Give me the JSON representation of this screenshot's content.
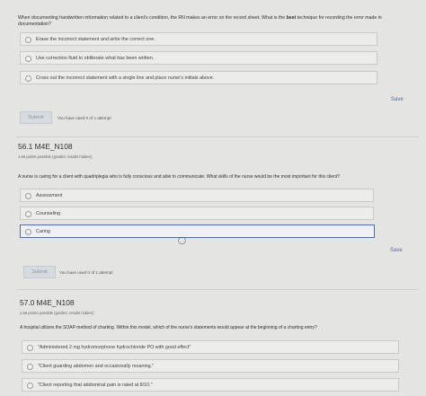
{
  "q55": {
    "prompt_part1": "When documenting handwritten information related to a client's condition, the RN makes an error on the record sheet. What is the ",
    "prompt_bold": "best",
    "prompt_part2": " technique for recording the error made in documentation?",
    "options": [
      "Erase the incorrect statement and write the correct one.",
      "Use correction fluid to obliterate what has been written.",
      "Cross out the incorrect statement with a single line and place nurse's initials above."
    ],
    "save_label": "Save",
    "submit_label": "Submit",
    "attempts": "You have used 0 of 1 attempt"
  },
  "q56": {
    "title": "56.1 M4E_N108",
    "meta": "1.66 points possible (graded, results hidden)",
    "prompt": "A nurse is caring for a client with quadriplegia who is fully conscious and able to communicate. What skills of the nurse would be the most important for this client?",
    "options": [
      "Assessment",
      "Counseling",
      "Caring"
    ],
    "selected_index": 2,
    "save_label": "Save",
    "submit_label": "Submit",
    "attempts": "You have used 0 of 1 attempt"
  },
  "q57": {
    "title": "57.0 M4E_N108",
    "meta": "1.66 points possible (graded, results hidden)",
    "prompt": "A hospital utilizes the SOAP method of charting. Within this model, which of the nurse's statements would appear at the beginning of a charting entry?",
    "options": [
      "\"Administered 2 mg hydromorphone hydrochloride PO with good effect\"",
      "\"Client guarding abdomen and occasionally moaning.\"",
      "\"Client reporting that abdominal pain is rated at 8/10.\""
    ]
  },
  "cursor_icon": "pointer-cursor-icon"
}
